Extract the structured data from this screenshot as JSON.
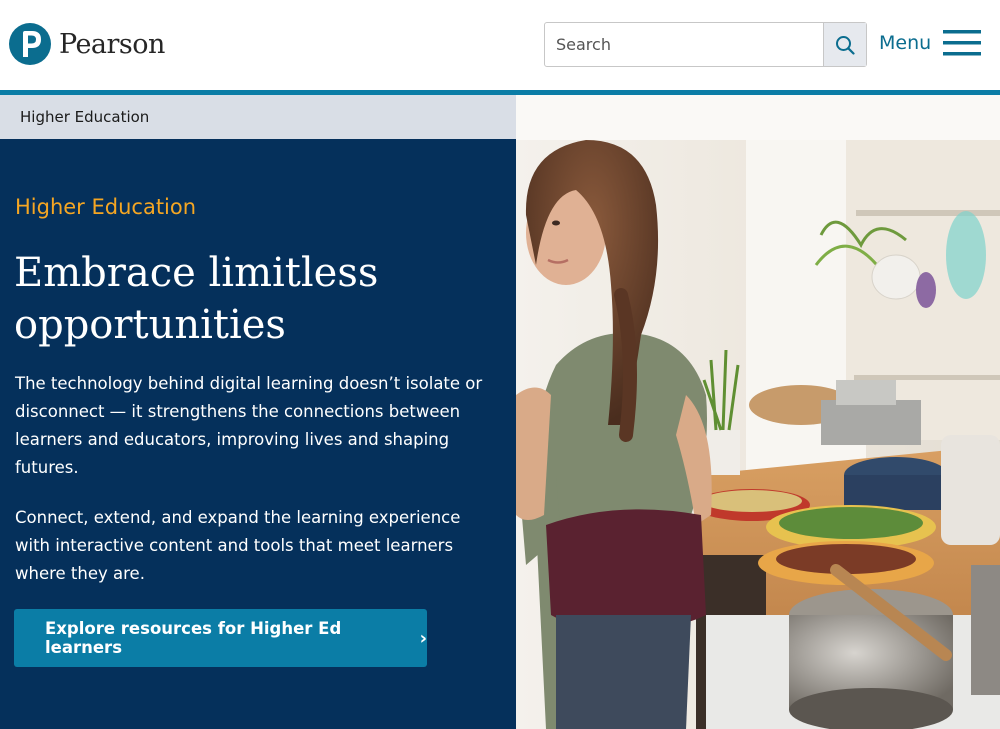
{
  "brand": {
    "name": "Pearson",
    "logo_icon": "pearson-p-logo-icon",
    "color": "#0b6d8f"
  },
  "search": {
    "placeholder": "Search",
    "icon": "search-icon"
  },
  "menu": {
    "label": "Menu",
    "icon": "hamburger-icon"
  },
  "breadcrumb": {
    "items": [
      "Higher Education"
    ]
  },
  "hero": {
    "eyebrow": "Higher Education",
    "title": "Embrace limitless opportunities",
    "paragraph1": "The technology behind digital learning doesn’t isolate or disconnect — it strengthens the connections between learners and educators, improving lives and shaping futures.",
    "paragraph2": "Connect, extend, and expand the learning experience with interactive content and tools that meet learners where they are.",
    "cta_label": "Explore resources for Higher Ed learners",
    "cta_icon": "chevron-right-icon"
  },
  "colors": {
    "navy": "#05305b",
    "teal": "#0b7da6",
    "accent_orange": "#f5a623",
    "breadcrumb_bg": "#d9dee6"
  }
}
